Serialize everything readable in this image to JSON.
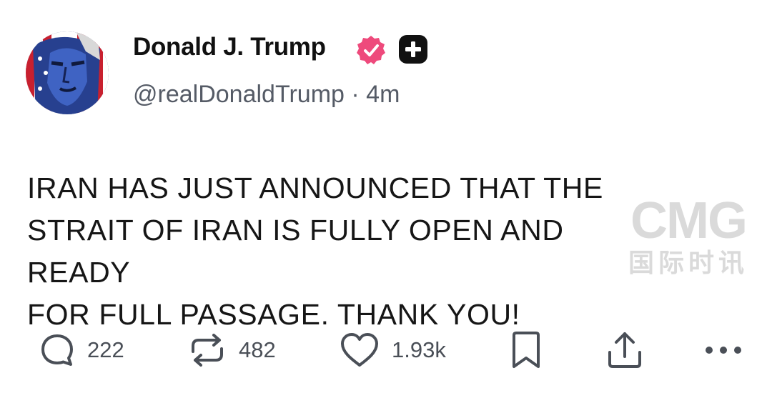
{
  "author": {
    "display_name": "Donald J. Trump",
    "handle": "@realDonaldTrump",
    "separator": "·",
    "timestamp": "4m",
    "avatar_icon": "flag-portrait-avatar",
    "verified_icon": "verified-badge-icon",
    "plus_icon": "plus-badge-icon"
  },
  "post": {
    "text": "IRAN HAS JUST ANNOUNCED THAT THE\nSTRAIT OF IRAN IS FULLY OPEN AND READY\nFOR FULL PASSAGE. THANK YOU!"
  },
  "watermark": {
    "logo": "CMG",
    "subtitle": "国际时讯"
  },
  "actions": {
    "reply_count": "222",
    "repost_count": "482",
    "like_count": "1.93k",
    "reply_icon": "reply-icon",
    "repost_icon": "repost-icon",
    "like_icon": "heart-icon",
    "bookmark_icon": "bookmark-icon",
    "share_icon": "share-icon",
    "more_icon": "more-icon"
  },
  "colors": {
    "verified": "#ee4a7c",
    "text": "#161616",
    "secondary": "#555b66",
    "icon": "#4a4f57"
  }
}
